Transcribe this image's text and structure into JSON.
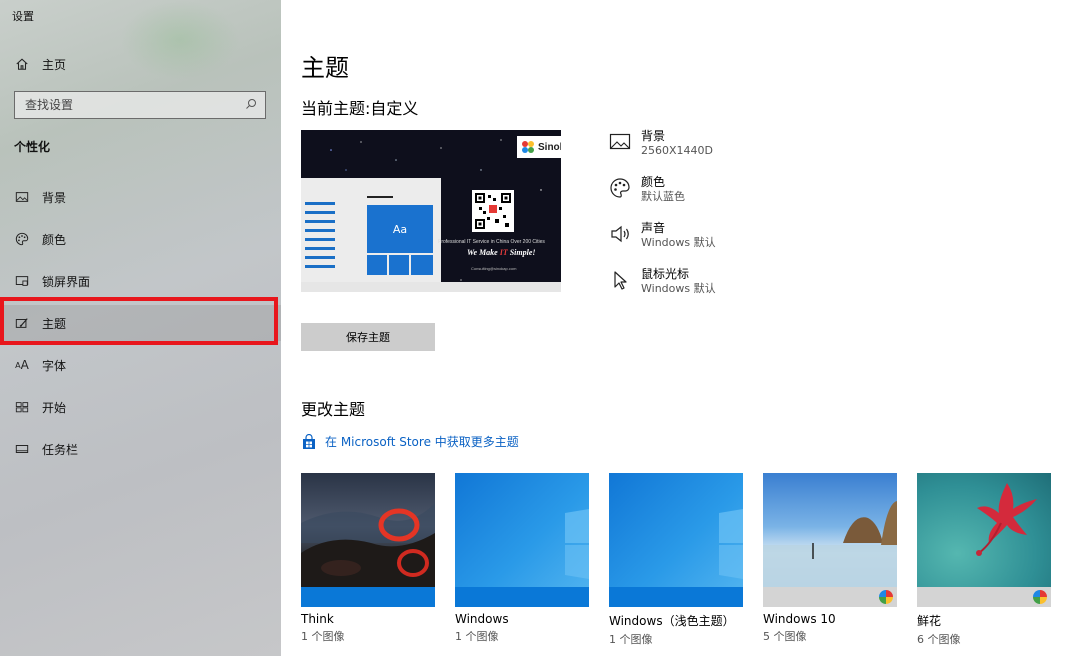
{
  "app": {
    "title": "设置"
  },
  "sidebar": {
    "home_label": "主页",
    "search_placeholder": "查找设置",
    "section_label": "个性化",
    "items": [
      {
        "label": "背景",
        "icon": "image-icon"
      },
      {
        "label": "颜色",
        "icon": "palette-icon"
      },
      {
        "label": "锁屏界面",
        "icon": "lock-screen-icon"
      },
      {
        "label": "主题",
        "icon": "theme-icon",
        "selected": true
      },
      {
        "label": "字体",
        "icon": "font-icon"
      },
      {
        "label": "开始",
        "icon": "start-icon"
      },
      {
        "label": "任务栏",
        "icon": "taskbar-icon"
      }
    ]
  },
  "main": {
    "page_title": "主题",
    "current_theme": "当前主题:自定义",
    "preview": {
      "logo_text": "Sinokap",
      "tile_label": "Aa",
      "text_line1": "Professional IT Service in China Over 200 Cities",
      "text_line2_pre": "We Make ",
      "text_line2_it": "IT",
      "text_line2_post": " Simple!",
      "text_line3": "Consulting@sinokap.com"
    },
    "properties": [
      {
        "title": "背景",
        "value": "2560X1440D",
        "icon": "image-icon"
      },
      {
        "title": "颜色",
        "value": "默认蓝色",
        "icon": "palette-icon"
      },
      {
        "title": "声音",
        "value": "Windows 默认",
        "icon": "speaker-icon"
      },
      {
        "title": "鼠标光标",
        "value": "Windows 默认",
        "icon": "cursor-icon"
      }
    ],
    "save_button": "保存主题",
    "change_theme_title": "更改主题",
    "store_link": "在 Microsoft Store 中获取更多主题",
    "themes": [
      {
        "name": "Think",
        "count": "1 个图像",
        "accent": "#0a78d7"
      },
      {
        "name": "Windows",
        "count": "1 个图像",
        "accent": "#0a78d7"
      },
      {
        "name": "Windows（浅色主题）",
        "count": "1 个图像",
        "accent": "#0a78d7"
      },
      {
        "name": "Windows 10",
        "count": "5 个图像",
        "accent": "#d4d4d4"
      },
      {
        "name": "鲜花",
        "count": "6 个图像",
        "accent": "#d4d4d4"
      }
    ]
  },
  "colors": {
    "accent": "#0b62c4",
    "highlight": "#e8161c"
  }
}
